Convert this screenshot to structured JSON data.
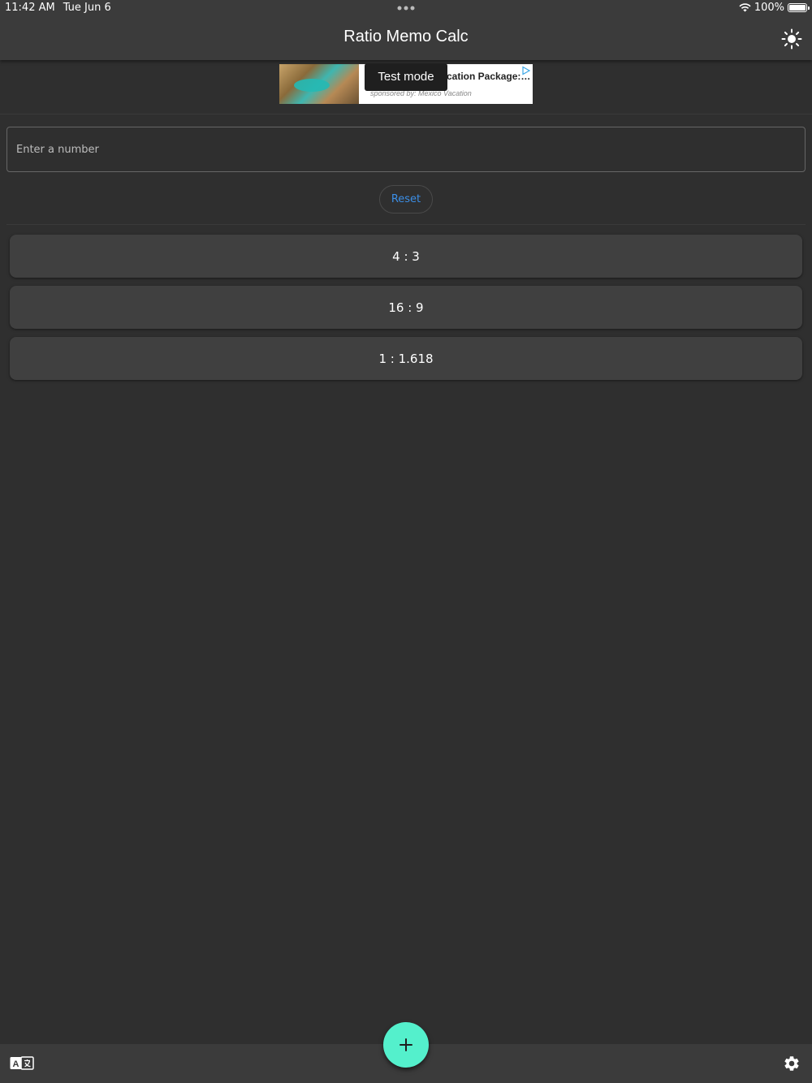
{
  "status_bar": {
    "time": "11:42 AM",
    "date": "Tue Jun 6",
    "battery": "100%"
  },
  "header": {
    "title": "Ratio Memo Calc",
    "theme_icon": "sun-icon"
  },
  "ad": {
    "headline": "cation Package:…",
    "sponsor": "sponsored by: Mexico Vacation",
    "test_mode_label": "Test mode",
    "choices_icon": "ad-choices-icon"
  },
  "input": {
    "placeholder": "Enter a number",
    "value": ""
  },
  "reset_label": "Reset",
  "ratios": [
    {
      "label": "4 : 3"
    },
    {
      "label": "16 : 9"
    },
    {
      "label": "1 : 1.618"
    }
  ],
  "bottom_bar": {
    "left_icon": "translate-icon",
    "right_icon": "gear-icon",
    "fab_icon": "plus-icon"
  },
  "colors": {
    "background": "#2f2f2f",
    "bar": "#3b3b3b",
    "card": "#404040",
    "accent": "#54f0cc",
    "link": "#3b8ee6"
  }
}
